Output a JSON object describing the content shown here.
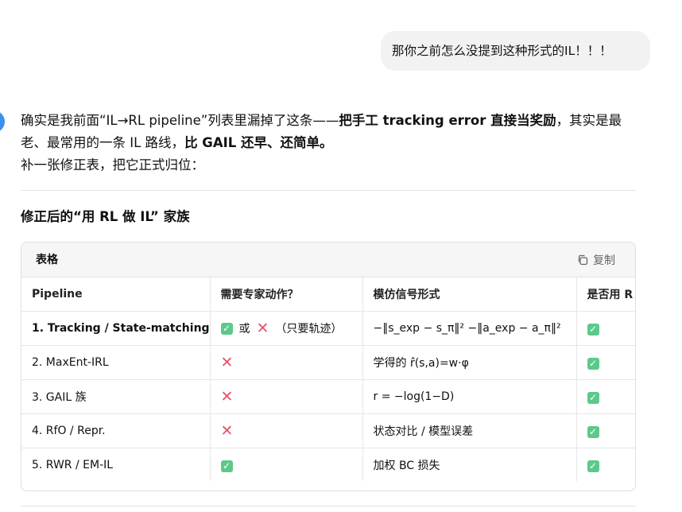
{
  "user_message": "那你之前怎么没提到这种形式的IL！！！",
  "answer": {
    "line1_text": "确实是我前面“IL→RL pipeline”列表里漏掉了这条——",
    "line1_bold_1": "把手工 tracking error 直接当奖励",
    "line1_tail": "，其实是最",
    "line2_text": "老、最常用的一条 IL 路线，",
    "line2_bold": "比 GAIL 还早、还简单。",
    "line3_text": "补一张修正表，把它正式归位："
  },
  "section_title": "修正后的“用 RL 做 IL” 家族",
  "table_card": {
    "label": "表格",
    "copy_label": "复制"
  },
  "table": {
    "headers": [
      "Pipeline",
      "需要专家动作？",
      "模仿信号形式",
      "是否用 R"
    ],
    "rows": [
      {
        "pipeline": "1. Tracking / State-matching",
        "expert_or": "或",
        "expert_note": "（只要轨迹）",
        "signal": "−‖s_exp − s_π‖² −‖a_exp − a_π‖²"
      },
      {
        "pipeline": "2. MaxEnt-IRL",
        "signal": "学得的 r̂(s,a)=w·φ"
      },
      {
        "pipeline": "3. GAIL 族",
        "signal": "r = −log(1−D)"
      },
      {
        "pipeline": "4. RfO / Repr.",
        "signal": "状态对比 / 模型误差"
      },
      {
        "pipeline": "5. RWR / EM-IL",
        "signal": "加权 BC 损失"
      }
    ]
  },
  "icons": {
    "check": "check-mark-icon",
    "cross": "cross-mark-icon",
    "copy": "copy-icon"
  },
  "colors": {
    "check_green": "#5cc98a",
    "cross_red": "#e8536b",
    "accent_blue": "#3b8ff0"
  }
}
